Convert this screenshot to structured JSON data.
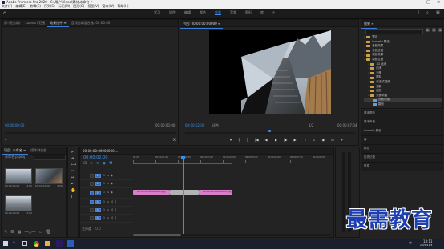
{
  "app": {
    "title": "Adobe Premiere Pro 2020 - C:\\用户\\Video\\素材\\未命名 *"
  },
  "menu": [
    "文件(F)",
    "编辑(E)",
    "剪辑(C)",
    "序列(S)",
    "标记(M)",
    "图形(G)",
    "视图(V)",
    "窗口(W)",
    "帮助(H)"
  ],
  "workspaces": [
    "学习",
    "组件",
    "编辑",
    "颜色",
    "效果",
    "音频",
    "图形",
    "库"
  ],
  "workspace_active": 4,
  "source_panel": {
    "tabs": [
      "源:(无剪辑)",
      "Lumetri 范围",
      "效果控件 ≡",
      "音频剪辑混合器: 00:00:00"
    ],
    "active_tab": 2,
    "tc_left": "00:00:00:00",
    "tc_right": "00:00:00:00"
  },
  "program": {
    "tab": "节目: 00:00:00:00000 ≡",
    "timecode": "00:00:02:00",
    "fit": "适合",
    "ratio": "1/2",
    "duration": "00:00:07:04"
  },
  "effects": {
    "title": "效果 ≡",
    "search_value": "",
    "items": [
      {
        "label": "预设",
        "level": 0
      },
      {
        "label": "Lumetri 预设",
        "level": 0
      },
      {
        "label": "音频效果",
        "level": 0
      },
      {
        "label": "音频过渡",
        "level": 0
      },
      {
        "label": "视频效果",
        "level": 0
      },
      {
        "label": "视频过渡",
        "level": 0
      },
      {
        "label": "3D 运动",
        "level": 1
      },
      {
        "label": "内滑",
        "level": 1
      },
      {
        "label": "划像",
        "level": 1
      },
      {
        "label": "擦除",
        "level": 1
      },
      {
        "label": "沉浸式视频",
        "level": 1
      },
      {
        "label": "溶解",
        "level": 1
      },
      {
        "label": "缩放",
        "level": 1
      },
      {
        "label": "页面剥落",
        "level": 1
      },
      {
        "label": "页面剥落",
        "level": 2
      },
      {
        "label": "翻页",
        "level": 2
      }
    ],
    "bottom_panels": [
      "基本图形",
      "基本声音",
      "Lumetri 颜色",
      "库",
      "标记",
      "历史记录",
      "信息"
    ]
  },
  "project": {
    "tabs": [
      "项目: 未命名 ≡",
      "媒体浏览器"
    ],
    "name": "未命名.prproj",
    "clips": [
      {
        "label": "00:00:00:00",
        "duration": "3:00"
      },
      {
        "label": "00:00:00:00",
        "duration": "3:00"
      },
      {
        "label": "00:00:00:00",
        "duration": "3:00"
      }
    ]
  },
  "timeline": {
    "tab": "00:00:00:00000000 ≡",
    "timecode": "00:00:02:00",
    "ruler": [
      "00:00",
      "00:00:01:00",
      "00:00:02:00",
      "00:00:03:00",
      "00:00:04:00",
      "00:00:05:00",
      "00:00:06:00",
      "00:00:07:00",
      "00:00:08:00"
    ],
    "tracks": [
      "V3",
      "V2",
      "V1",
      "A1",
      "A2",
      "A3"
    ],
    "master": "主声道",
    "master_value": "0.0",
    "clips": [
      {
        "label": "00:00:00:00000000.jpg",
        "color": "#d77fc9"
      },
      {
        "label": "",
        "color": "#b3b3b3"
      },
      {
        "label": "00:00:00:00000000.jpg",
        "color": "#d77fc9"
      }
    ]
  },
  "watermark": "最需教育",
  "taskbar": {
    "time": "13:11",
    "date": "2021/11/4",
    "lang": "中"
  },
  "colors": {
    "accent": "#3d8ee8",
    "clip": "#d77fc9",
    "transition": "#b3b3b3",
    "playhead": "#3d8ee8"
  }
}
